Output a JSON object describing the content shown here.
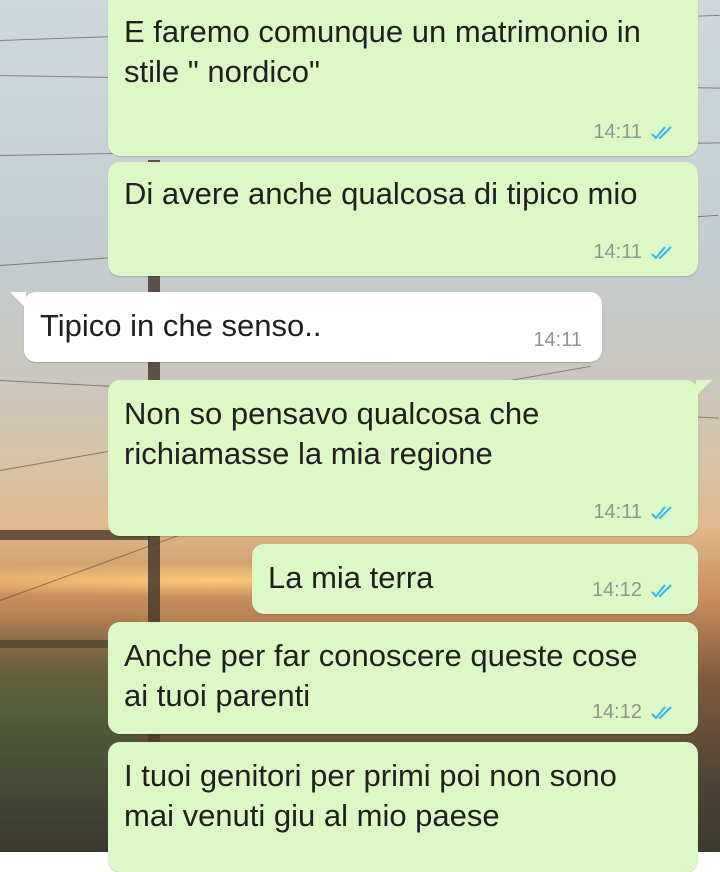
{
  "messages": [
    {
      "direction": "out",
      "text": "E faremo comunque un matrimonio in stile \" nordico\"",
      "time": "14:11",
      "status": "read-double-check-icon"
    },
    {
      "direction": "out",
      "text": "Di avere anche qualcosa di tipico mio",
      "time": "14:11",
      "status": "read-double-check-icon"
    },
    {
      "direction": "in",
      "text": "Tipico in che senso..",
      "time": "14:11"
    },
    {
      "direction": "out",
      "text": "Non so pensavo qualcosa che richiamasse la mia regione",
      "time": "14:11",
      "status": "read-double-check-icon"
    },
    {
      "direction": "out",
      "text": "La mia terra",
      "time": "14:12",
      "status": "read-double-check-icon"
    },
    {
      "direction": "out",
      "text": "Anche per far conoscere queste cose ai tuoi parenti",
      "time": "14:12",
      "status": "read-double-check-icon"
    },
    {
      "direction": "out",
      "text": "I tuoi genitori per primi poi non sono mai venuti giu al mio paese",
      "time": "",
      "status": ""
    }
  ],
  "colors": {
    "outgoing_bubble": "#dcf8c6",
    "incoming_bubble": "#ffffff",
    "read_ticks": "#34b7f1",
    "timestamp": "#8c9791"
  }
}
